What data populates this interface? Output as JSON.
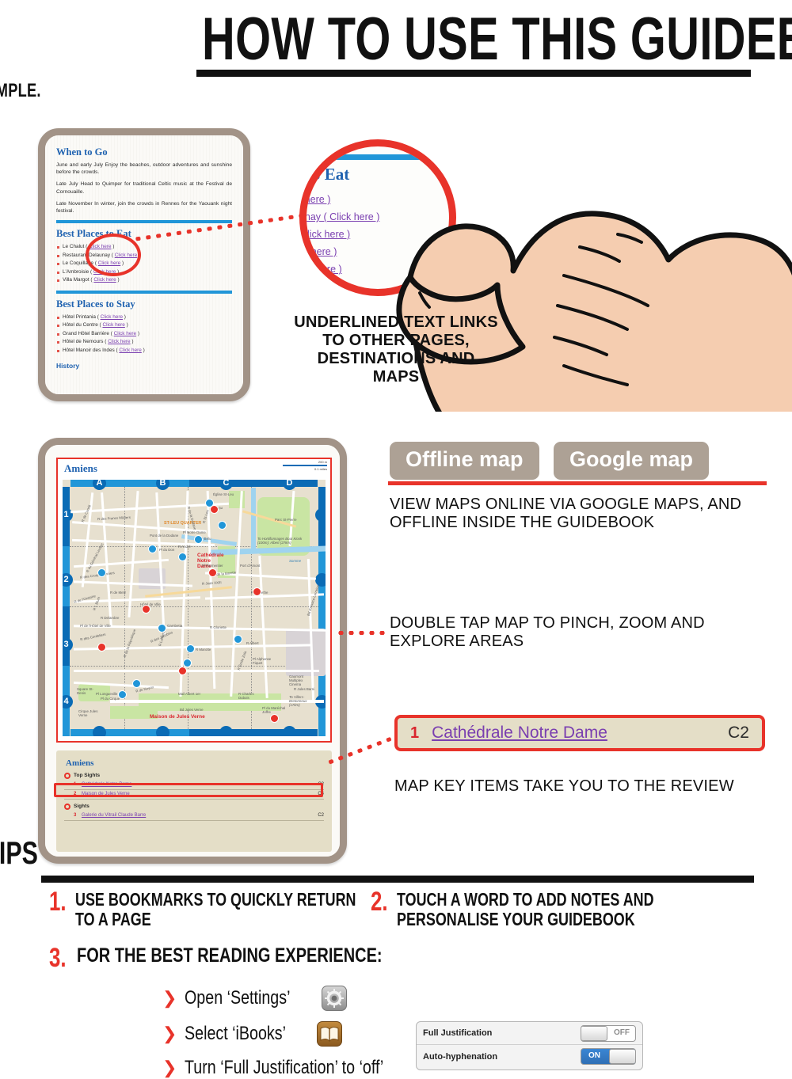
{
  "header": {
    "title": "HOW TO USE THIS GUIDEBOOK",
    "subtitle": "IT'S REALLY VERY SIMPLE."
  },
  "text_page": {
    "when_to_go": {
      "heading": "When to Go",
      "paragraphs": [
        "June and early July Enjoy the beaches, outdoor adventures and sunshine before the crowds.",
        "Late July Head to Quimper for traditional Celtic music at the Festival de Cornouaille.",
        "Late November In winter, join the crowds in Rennes for the Yaouank night festival."
      ]
    },
    "eat": {
      "heading": "Best Places to Eat",
      "link_label": "Click here",
      "items": [
        "Le Chalut",
        "Restaurant Delaunay",
        "Le Coquillage",
        "L'Ambroisie",
        "Villa Margot"
      ]
    },
    "stay": {
      "heading": "Best Places to Stay",
      "link_label": "Click here",
      "items": [
        "Hôtel Printania",
        "Hôtel du Centre",
        "Grand Hôtel Barrière",
        "Hôtel de Nemours",
        "Hôtel Manoir des Indes"
      ]
    },
    "history_heading": "History"
  },
  "magnifier": {
    "heading": "to Eat",
    "rows": [
      "k here )",
      "aunay ( Click here )",
      "Click here )",
      "k here )",
      "here )"
    ]
  },
  "callouts": {
    "underlined_text": "UNDERLINED TEXT LINKS TO OTHER PAGES, DESTINATIONS AND MAPS",
    "maps": "VIEW MAPS ONLINE VIA GOOGLE MAPS, AND OFFLINE INSIDE THE GUIDEBOOK",
    "double_tap": "DOUBLE TAP MAP TO PINCH, ZOOM AND EXPLORE AREAS",
    "map_key": "MAP KEY ITEMS TAKE YOU TO THE REVIEW"
  },
  "map_buttons": {
    "offline": "Offline map",
    "google": "Google map"
  },
  "map_page": {
    "title": "Amiens",
    "scale": {
      "metric": "200 m",
      "imperial": "0.1 miles"
    },
    "grid_cols": [
      "A",
      "B",
      "C",
      "D"
    ],
    "grid_rows": [
      "1",
      "2",
      "3",
      "4"
    ],
    "labels": [
      "R des Francs Mûriers",
      "R du Général Leclerc",
      "R de Condé",
      "R des Croquebonniers",
      "R de Metz",
      "R Delambre",
      "Pl de l'Hôtel de Ville",
      "Hôtel de Ville",
      "R L Blum",
      "Gambetta",
      "R André",
      "R Perdu",
      "R St-Leu",
      "Église St-Leu",
      "ST-LEU QUARTER",
      "R de la Dodane",
      "Pont de la Dodane",
      "Q Bélu",
      "Pl du Don",
      "Pl Notre Dame",
      "Cathédrale Notre Dame",
      "Pl Parmentier",
      "Port d'Amont",
      "Parc St-Pierre",
      "To Hortillonnages Boat Kiosk (100m); Albert (27km)",
      "Somme",
      "R de la Barette",
      "R Jean XXIII",
      "R Lamethe",
      "R de l'Oratoire",
      "Bd d'Alsace-Lorraine",
      "R Gloriette",
      "R Lamartine",
      "Square St-Denis",
      "R de Noyon",
      "Pl Alphonse Fiquet",
      "Gaumont Multiplex Cinema",
      "R des Cordeliers",
      "R de la République",
      "R des Jacobins",
      "R Marotte",
      "R Albert",
      "R Émile Zola",
      "Pl Longueville",
      "Pl du Cirque",
      "Cirque Jules Verne",
      "Mail Albert 1er",
      "R Charles Dubois",
      "Bd Jules Verne",
      "Maison de Jules Verne",
      "Pl du Maréchal Joffre",
      "To Villers-Bretonneux (17km)",
      "R Jules Barni"
    ]
  },
  "map_key": {
    "city": "Amiens",
    "sections": [
      {
        "name": "Top Sights",
        "rows": [
          {
            "num": "1",
            "name": "Cathédrale Notre Dame",
            "grid": "C2"
          },
          {
            "num": "2",
            "name": "Maison de Jules Verne",
            "grid": "C4"
          }
        ]
      },
      {
        "name": "Sights",
        "rows": [
          {
            "num": "3",
            "name": "Galerie du Vitrail Claude Barre",
            "grid": "C2"
          }
        ]
      }
    ]
  },
  "key_callout": {
    "num": "1",
    "name": "Cathédrale Notre Dame",
    "grid": "C2"
  },
  "tips": {
    "heading": "TIPS",
    "items": [
      {
        "num": "1.",
        "text": "USE BOOKMARKS TO QUICKLY RETURN TO A PAGE"
      },
      {
        "num": "2.",
        "text": "TOUCH A WORD TO ADD NOTES AND PERSONALISE YOUR GUIDEBOOK"
      },
      {
        "num": "3.",
        "text": "FOR THE BEST READING EXPERIENCE:"
      }
    ],
    "sub_items": [
      {
        "text": "Open ‘Settings’",
        "icon": "settings-app-icon"
      },
      {
        "text": "Select ‘iBooks’",
        "icon": "ibooks-app-icon"
      },
      {
        "text": "Turn ‘Full Justification’ to ‘off’",
        "icon": ""
      }
    ]
  },
  "ios_settings": {
    "rows": [
      {
        "label": "Full Justification",
        "state": "OFF"
      },
      {
        "label": "Auto-hyphenation",
        "state": "ON"
      }
    ]
  },
  "colors": {
    "red": "#e8332a",
    "blue": "#1f62b0",
    "link_purple": "#7a3fb0",
    "device_frame": "#a29387",
    "button_taupe": "#ada195",
    "key_panel": "#e4dec7"
  }
}
